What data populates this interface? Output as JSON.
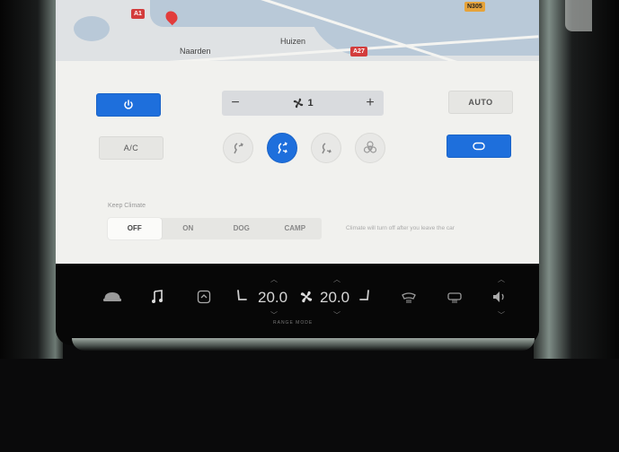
{
  "map": {
    "places": [
      "Naarden",
      "Huizen"
    ],
    "shields": [
      "A1",
      "A27",
      "N305"
    ]
  },
  "climate": {
    "power_icon": "power-icon",
    "fan_minus": "−",
    "fan_plus": "+",
    "fan_speed": "1",
    "auto_label": "AUTO",
    "ac_label": "A/C",
    "recirculate_icon": "recirculate-icon",
    "airflow_modes": [
      "face",
      "face-feet",
      "feet",
      "defrost"
    ],
    "airflow_active": "face-feet",
    "keep_climate": {
      "label": "Keep Climate",
      "options": [
        "OFF",
        "ON",
        "DOG",
        "CAMP"
      ],
      "selected": "OFF",
      "note": "Climate will turn off after you leave the car"
    }
  },
  "control_bar": {
    "driver_temp": "20.0",
    "passenger_temp": "20.0",
    "range_mode": "RANGE MODE",
    "icons": [
      "car-icon",
      "music-icon",
      "apps-icon",
      "driver-seat-icon",
      "fan-icon",
      "passenger-seat-icon",
      "front-defrost-icon",
      "rear-defrost-icon",
      "volume-icon"
    ]
  },
  "colors": {
    "accent": "#1e6fdc",
    "panel_bg": "#f1f1ee",
    "bar_bg": "#070707"
  }
}
